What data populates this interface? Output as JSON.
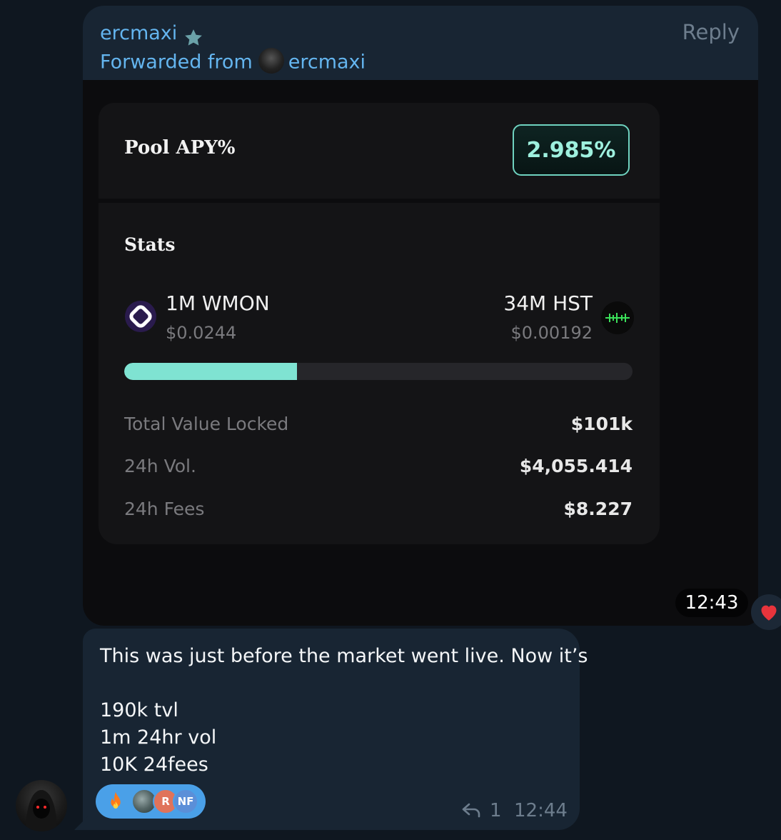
{
  "forwarded_message": {
    "sender": "ercmaxi",
    "reply_label": "Reply",
    "forwarded_prefix": "Forwarded from",
    "forwarded_from": "ercmaxi",
    "time": "12:43",
    "reaction": "heart"
  },
  "pool_card": {
    "apy_label": "Pool APY%",
    "apy_value": "2.985%",
    "stats_title": "Stats",
    "token_a": {
      "amount": "1M WMON",
      "price": "$0.0244",
      "icon": "wmon-icon"
    },
    "token_b": {
      "amount": "34M HST",
      "price": "$0.00192",
      "icon": "hst-icon"
    },
    "ratio_fill_fraction": 0.34,
    "stats": [
      {
        "label": "Total Value Locked",
        "value": "$101k"
      },
      {
        "label": "24h Vol.",
        "value": "$4,055.414"
      },
      {
        "label": "24h Fees",
        "value": "$8.227"
      }
    ]
  },
  "reply_message": {
    "lines": [
      "This was just before the market went live. Now it’s",
      "190k tvl",
      "1m 24hr vol",
      "10K 24fees"
    ],
    "reactions": {
      "emoji": "fire",
      "avatars": [
        "",
        "R",
        "NF"
      ]
    },
    "reply_count": "1",
    "time": "12:44"
  },
  "colors": {
    "accent": "#64b5ef",
    "bubble": "#182533",
    "apy_teal": "#6fd3c0",
    "bar_fill": "#7fe3d2"
  }
}
